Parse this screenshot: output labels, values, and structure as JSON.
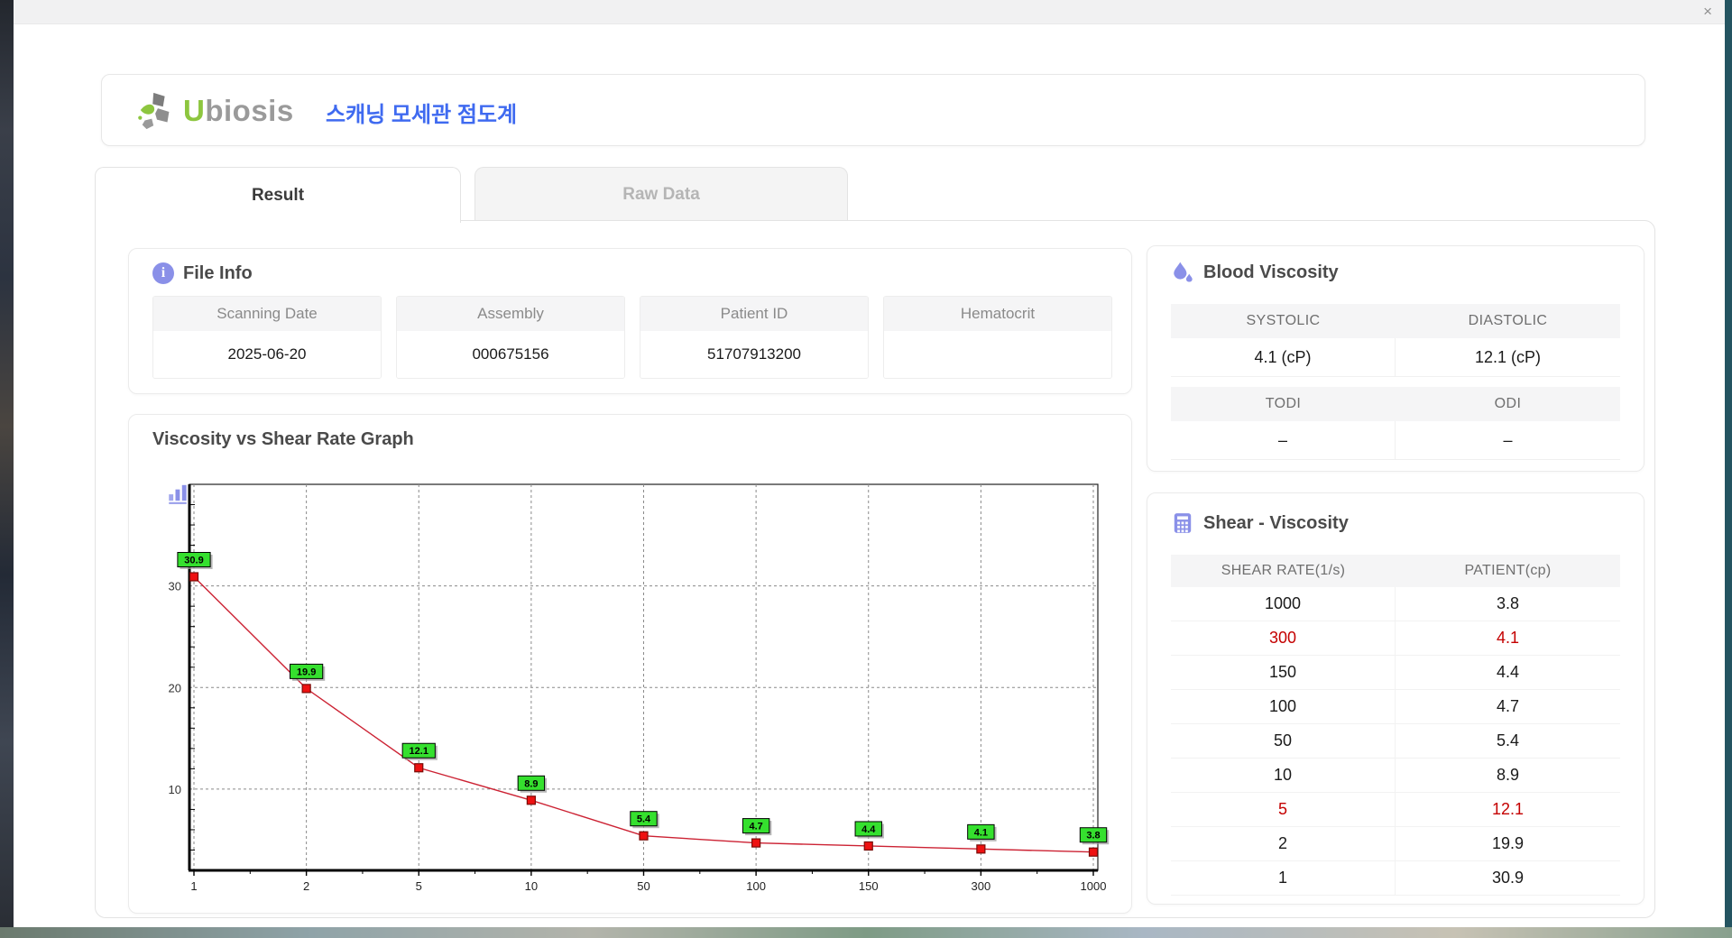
{
  "titlebar": {
    "close_glyph": "×"
  },
  "header": {
    "logo_u": "U",
    "logo_rest": "biosis",
    "app_title": "스캐닝 모세관 점도계"
  },
  "tabs": [
    {
      "label": "Result",
      "active": true
    },
    {
      "label": "Raw Data",
      "active": false
    }
  ],
  "file_info": {
    "title": "File Info",
    "fields": [
      {
        "label": "Scanning Date",
        "value": "2025-06-20"
      },
      {
        "label": "Assembly",
        "value": "000675156"
      },
      {
        "label": "Patient ID",
        "value": "51707913200"
      },
      {
        "label": "Hematocrit",
        "value": ""
      }
    ]
  },
  "graph": {
    "title": "Viscosity vs Shear Rate Graph"
  },
  "blood_viscosity": {
    "title": "Blood Viscosity",
    "table1": {
      "col1": "SYSTOLIC",
      "val1": "4.1 (cP)",
      "col2": "DIASTOLIC",
      "val2": "12.1 (cP)"
    },
    "table2": {
      "col1": "TODI",
      "val1": "–",
      "col2": "ODI",
      "val2": "–"
    }
  },
  "shear_viscosity": {
    "title": "Shear - Viscosity",
    "columns": [
      "SHEAR RATE(1/s)",
      "PATIENT(cp)"
    ],
    "rows": [
      {
        "shear": "1000",
        "patient": "3.8",
        "highlight": false
      },
      {
        "shear": "300",
        "patient": "4.1",
        "highlight": true
      },
      {
        "shear": "150",
        "patient": "4.4",
        "highlight": false
      },
      {
        "shear": "100",
        "patient": "4.7",
        "highlight": false
      },
      {
        "shear": "50",
        "patient": "5.4",
        "highlight": false
      },
      {
        "shear": "10",
        "patient": "8.9",
        "highlight": false
      },
      {
        "shear": "5",
        "patient": "12.1",
        "highlight": true
      },
      {
        "shear": "2",
        "patient": "19.9",
        "highlight": false
      },
      {
        "shear": "1",
        "patient": "30.9",
        "highlight": false
      }
    ]
  },
  "chart_data": {
    "type": "line",
    "title": "Viscosity vs Shear Rate Graph",
    "categories": [
      "1",
      "2",
      "5",
      "10",
      "50",
      "100",
      "150",
      "300",
      "1000"
    ],
    "values": [
      30.9,
      19.9,
      12.1,
      8.9,
      5.4,
      4.7,
      4.4,
      4.1,
      3.8
    ],
    "y_ticks": [
      10,
      20,
      30
    ],
    "ylim": [
      2,
      40
    ],
    "grid": "dashed",
    "data_labels_shown": true,
    "line_color": "#cc2233",
    "marker_color": "#ee1111",
    "marker_border": "#7a0c08",
    "label_bg": "#35e02e",
    "label_border": "#000000",
    "grid_color": "#8a8a8a",
    "axis_color": "#000000"
  },
  "colors": {
    "accent_icon": "#8a90e8",
    "title_blue": "#3f6af0",
    "logo_green": "#8dc63f",
    "alert_red": "#c40000"
  }
}
